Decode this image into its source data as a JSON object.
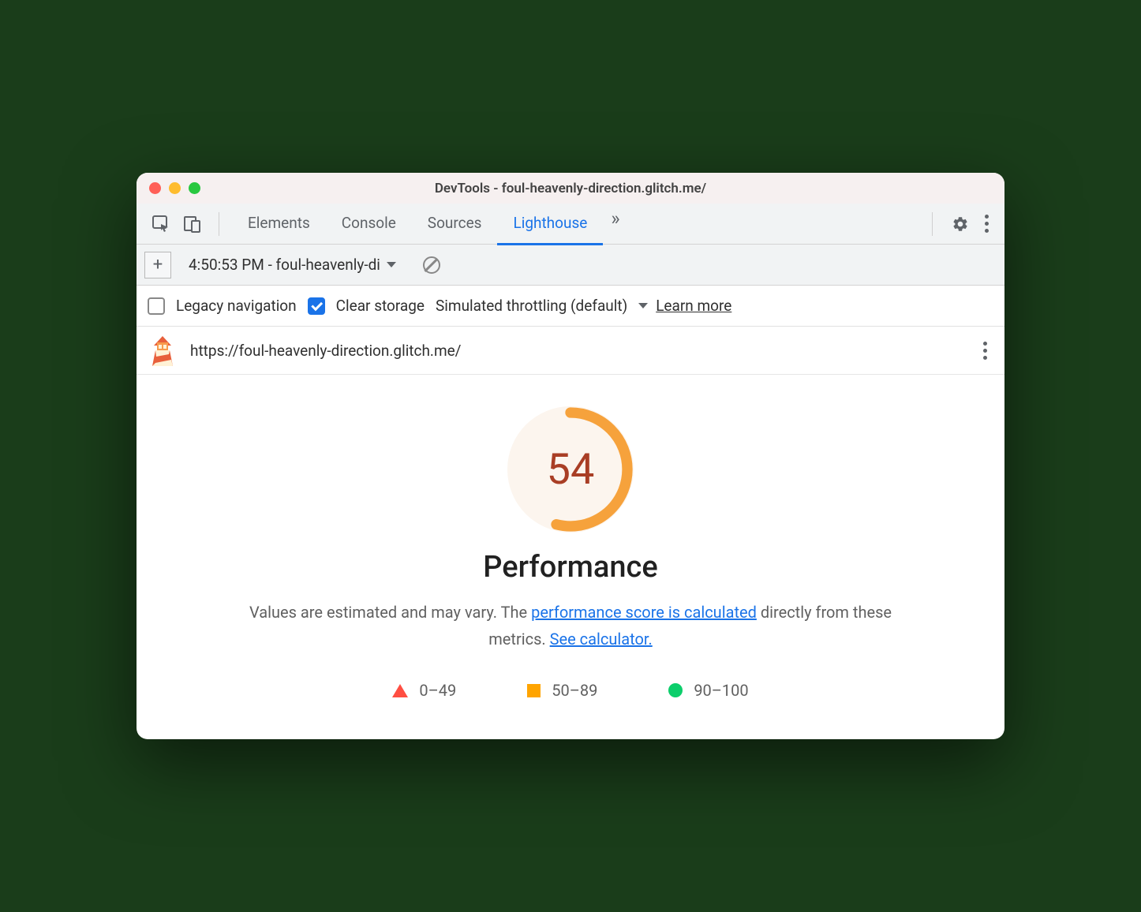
{
  "window": {
    "title": "DevTools - foul-heavenly-direction.glitch.me/"
  },
  "tabs": {
    "elements": "Elements",
    "console": "Console",
    "sources": "Sources",
    "lighthouse": "Lighthouse"
  },
  "sub": {
    "dropdown": "4:50:53 PM - foul-heavenly-di"
  },
  "options": {
    "legacy": "Legacy navigation",
    "clear": "Clear storage",
    "throttle": "Simulated throttling (default)",
    "learn": "Learn more"
  },
  "url": "https://foul-heavenly-direction.glitch.me/",
  "report": {
    "score": "54",
    "title": "Performance",
    "desc_prefix": "Values are estimated and may vary. The ",
    "desc_link1": "performance score is calculated",
    "desc_mid": " directly from these metrics. ",
    "desc_link2": "See calculator.",
    "legend": {
      "r1": "0–49",
      "r2": "50–89",
      "r3": "90–100"
    }
  },
  "chart_data": {
    "type": "gauge",
    "value": 54,
    "max": 100,
    "title": "Performance",
    "ranges": [
      {
        "label": "0–49",
        "color": "#ff4e42"
      },
      {
        "label": "50–89",
        "color": "#ffa400"
      },
      {
        "label": "90–100",
        "color": "#0cce6b"
      }
    ]
  }
}
